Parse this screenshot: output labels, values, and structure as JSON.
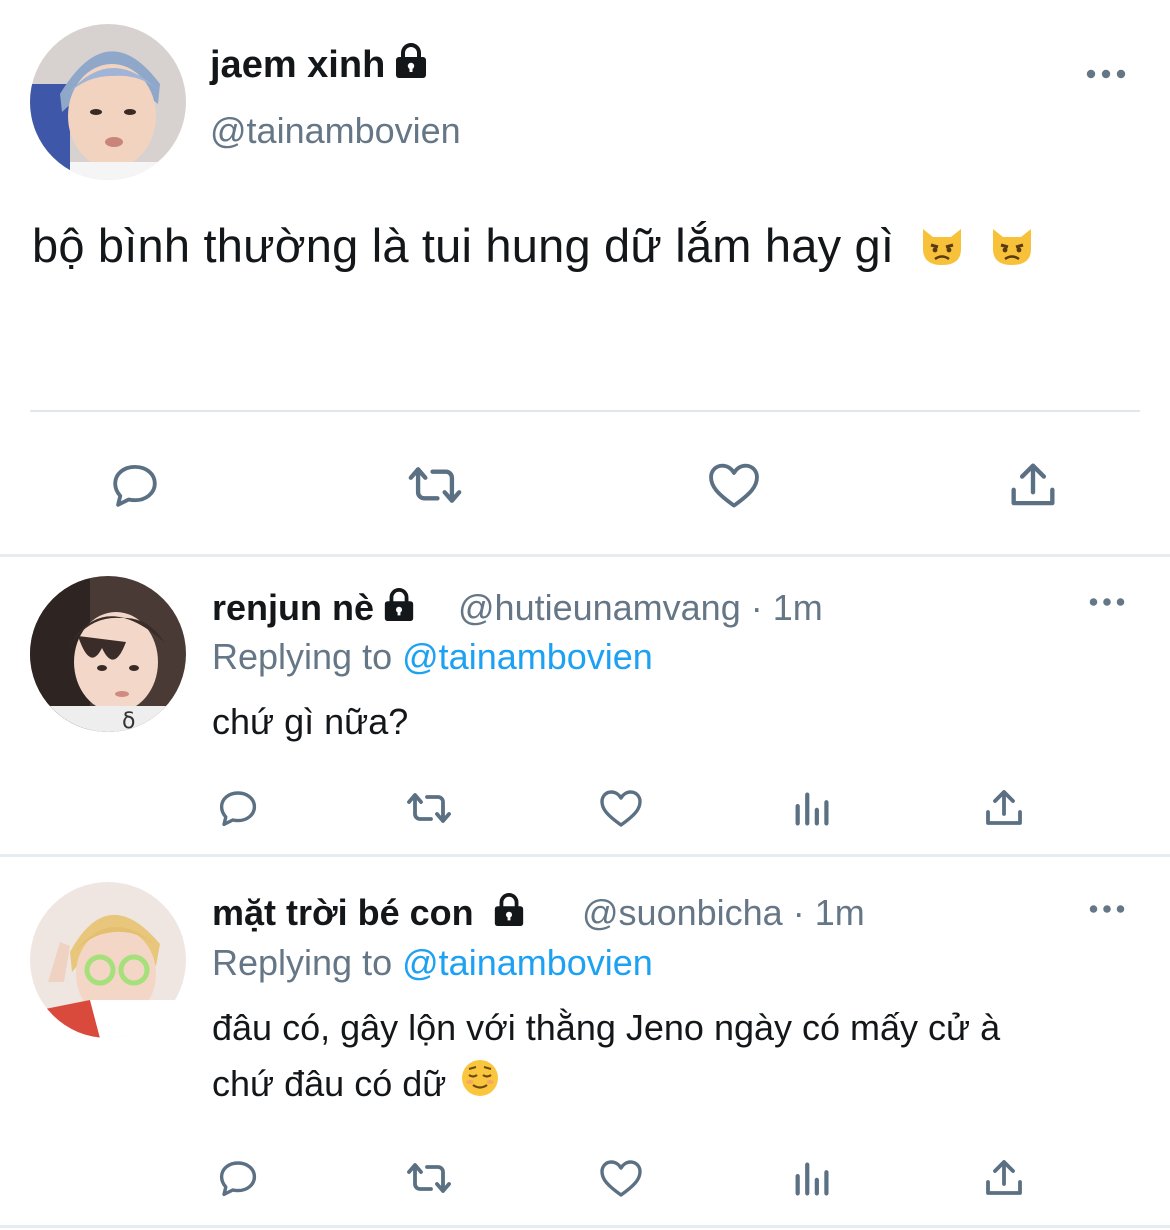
{
  "main_tweet": {
    "display_name": "jaem xinh",
    "handle": "@tainambovien",
    "text": "bộ bình thường là tui hung dữ lắm hay gì",
    "emoji": [
      "pouting-cat",
      "pouting-cat"
    ]
  },
  "replies": [
    {
      "display_name": "renjun nè",
      "handle": "@hutieunamvang",
      "separator": "·",
      "time": "1m",
      "replying_label": "Replying to",
      "replying_to": "@tainambovien",
      "text_lines": [
        "chứ gì nữa?"
      ]
    },
    {
      "display_name": "mặt trời bé con",
      "handle": "@suonbicha",
      "separator": "·",
      "time": "1m",
      "replying_label": "Replying to",
      "replying_to": "@tainambovien",
      "text_lines": [
        "đâu có, gây lộn với thằng Jeno ngày có mấy cử à",
        "chứ đâu có dữ"
      ],
      "emoji": "relieved-face"
    }
  ],
  "colors": {
    "text": "#14171a",
    "secondary": "#657786",
    "link": "#1da1f2",
    "icon": "#5b7083",
    "divider": "#e1e8ed"
  }
}
